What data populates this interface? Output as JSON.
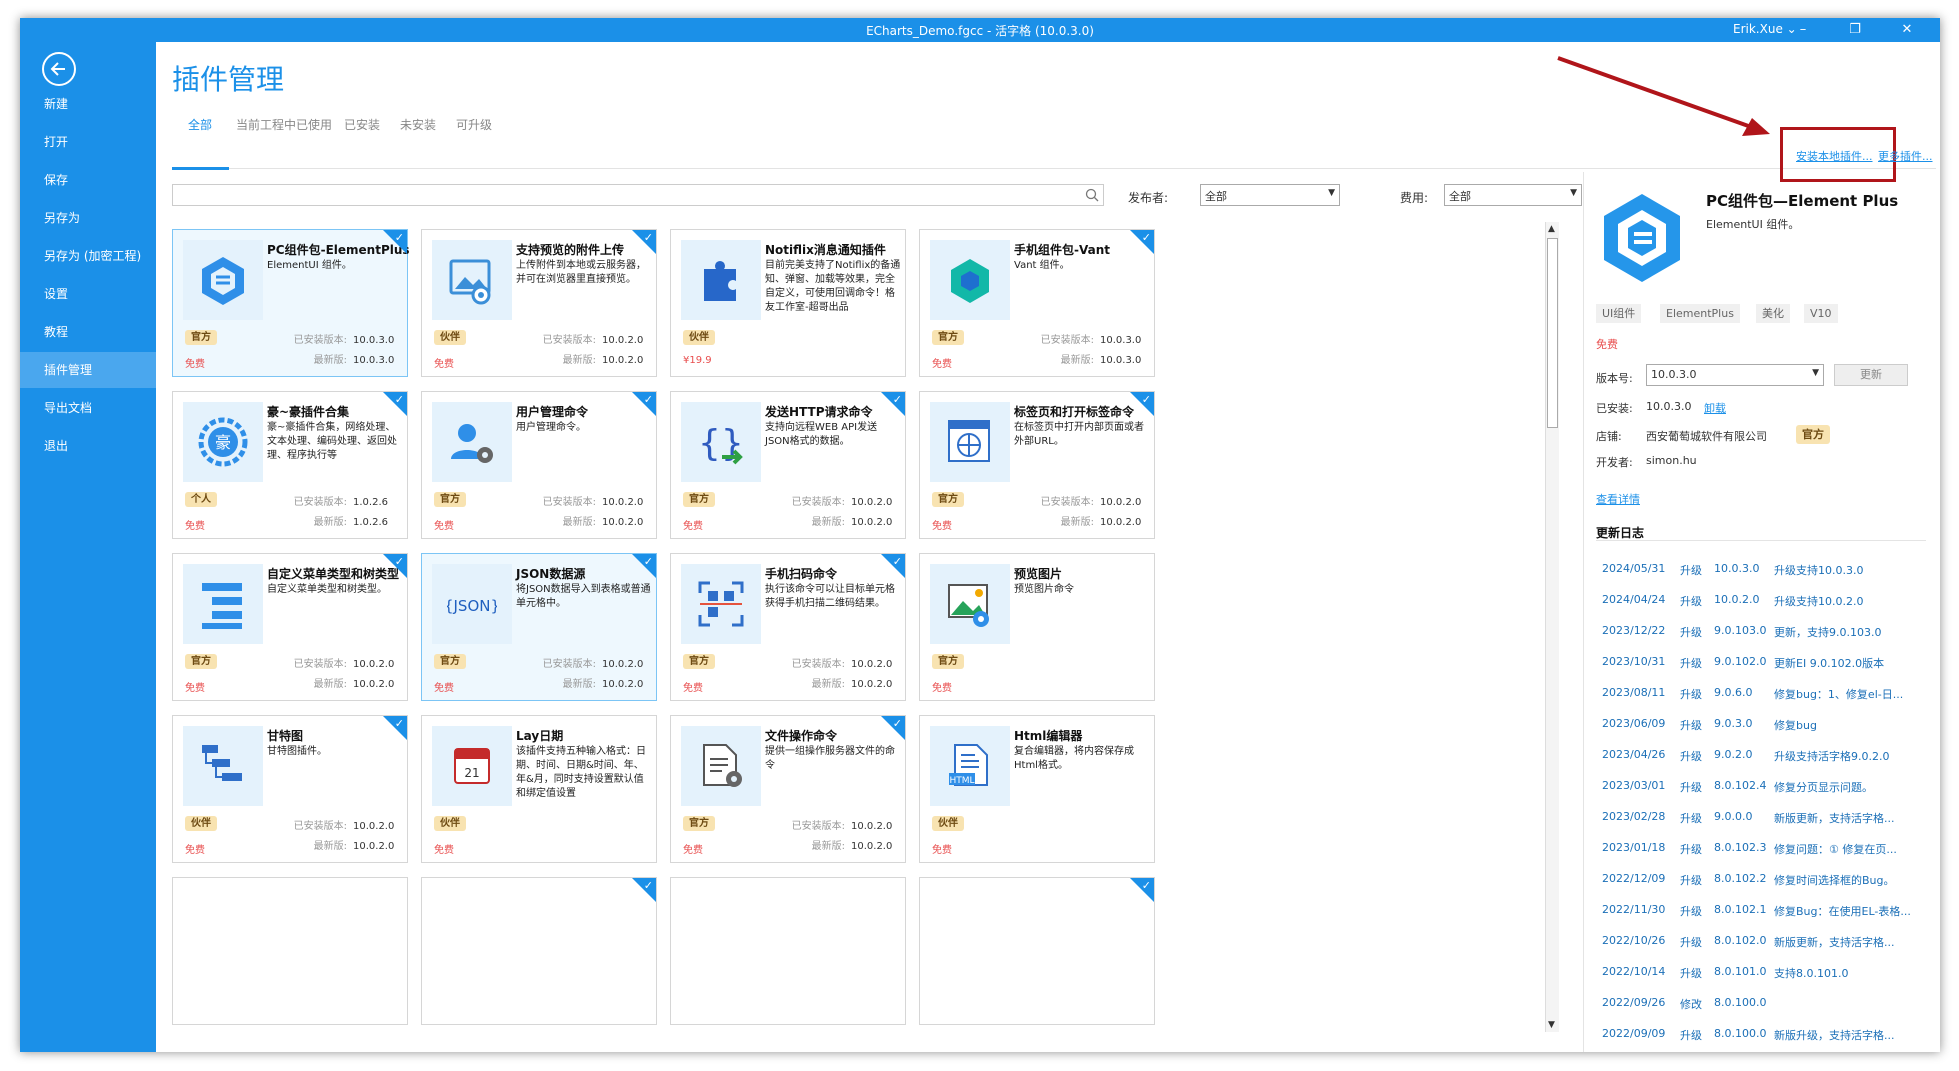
{
  "window": {
    "title": "ECharts_Demo.fgcc - 活字格 (10.0.3.0)",
    "user": "Erik.Xue",
    "minimize": "–",
    "restore": "❐",
    "close": "✕"
  },
  "sidebar": {
    "items": [
      {
        "label": "新建"
      },
      {
        "label": "打开"
      },
      {
        "label": "保存"
      },
      {
        "label": "另存为"
      },
      {
        "label": "另存为 (加密工程)"
      },
      {
        "label": "设置"
      },
      {
        "label": "教程"
      },
      {
        "label": "插件管理"
      },
      {
        "label": "导出文档"
      },
      {
        "label": "退出"
      }
    ],
    "active_index": 7
  },
  "page": {
    "title": "插件管理"
  },
  "tabs": [
    {
      "label": "全部"
    },
    {
      "label": "当前工程中已使用"
    },
    {
      "label": "已安装"
    },
    {
      "label": "未安装"
    },
    {
      "label": "可升级"
    }
  ],
  "filters": {
    "publisher_label": "发布者:",
    "publisher_value": "全部",
    "fee_label": "费用:",
    "fee_value": "全部"
  },
  "links": {
    "install_local": "安装本地插件...",
    "more_plugins": "更多插件..."
  },
  "labels": {
    "installed_version": "已安装版本:",
    "latest_version": "最新版:"
  },
  "cards": [
    {
      "name": "PC组件包-ElementPlus",
      "desc": "ElementUI 组件。",
      "tag": "官方",
      "price": "免费",
      "installed": "10.0.3.0",
      "latest": "10.0.3.0",
      "icon": "elementplus-hexagon-icon",
      "checked": true,
      "selected": true
    },
    {
      "name": "支持预览的附件上传",
      "desc": "上传附件到本地或云服务器，并可在浏览器里直接预览。",
      "tag": "伙伴",
      "price": "免费",
      "installed": "10.0.2.0",
      "latest": "10.0.2.0",
      "icon": "image-preview-icon",
      "checked": true,
      "selected": false
    },
    {
      "name": "Notiflix消息通知插件",
      "desc": "目前完美支持了Notiflix的备通知、弹窗、加载等效果，完全自定义，可使用回调命令！格友工作室-超哥出品",
      "tag": "伙伴",
      "price": "¥19.9",
      "installed": "",
      "latest": "",
      "icon": "puzzle-icon",
      "checked": false,
      "selected": false
    },
    {
      "name": "手机组件包-Vant",
      "desc": "Vant 组件。",
      "tag": "官方",
      "price": "免费",
      "installed": "10.0.3.0",
      "latest": "10.0.3.0",
      "icon": "vant-cube-icon",
      "checked": true,
      "selected": false
    },
    {
      "name": "豪~豪插件合集",
      "desc": "豪~豪插件合集，网络处理、文本处理、编码处理、返回处理、程序执行等",
      "tag": "个人",
      "price": "免费",
      "installed": "1.0.2.6",
      "latest": "1.0.2.6",
      "icon": "hao-badge-icon",
      "checked": true,
      "selected": false
    },
    {
      "name": "用户管理命令",
      "desc": "用户管理命令。",
      "tag": "官方",
      "price": "免费",
      "installed": "10.0.2.0",
      "latest": "10.0.2.0",
      "icon": "user-gear-icon",
      "checked": true,
      "selected": false
    },
    {
      "name": "发送HTTP请求命令",
      "desc": "支持向远程WEB API发送JSON格式的数据。",
      "tag": "官方",
      "price": "免费",
      "installed": "10.0.2.0",
      "latest": "10.0.2.0",
      "icon": "http-braces-icon",
      "checked": true,
      "selected": false
    },
    {
      "name": "标签页和打开标签命令",
      "desc": "在标签页中打开内部页面或者外部URL。",
      "tag": "官方",
      "price": "免费",
      "installed": "10.0.2.0",
      "latest": "10.0.2.0",
      "icon": "browser-globe-icon",
      "checked": true,
      "selected": false
    },
    {
      "name": "自定义菜单类型和树类型",
      "desc": "自定义菜单类型和树类型。",
      "tag": "官方",
      "price": "免费",
      "installed": "10.0.2.0",
      "latest": "10.0.2.0",
      "icon": "tree-menu-icon",
      "checked": true,
      "selected": false
    },
    {
      "name": "JSON数据源",
      "desc": "将JSON数据导入到表格或普通单元格中。",
      "tag": "官方",
      "price": "免费",
      "installed": "10.0.2.0",
      "latest": "10.0.2.0",
      "icon": "json-icon",
      "checked": true,
      "selected": true
    },
    {
      "name": "手机扫码命令",
      "desc": "执行该命令可以让目标单元格获得手机扫描二维码结果。",
      "tag": "官方",
      "price": "免费",
      "installed": "10.0.2.0",
      "latest": "10.0.2.0",
      "icon": "qr-scan-icon",
      "checked": true,
      "selected": false
    },
    {
      "name": "预览图片",
      "desc": "预览图片命令",
      "tag": "官方",
      "price": "免费",
      "installed": "",
      "latest": "",
      "icon": "image-eye-icon",
      "checked": false,
      "selected": false
    },
    {
      "name": "甘特图",
      "desc": "甘特图插件。",
      "tag": "伙伴",
      "price": "免费",
      "installed": "10.0.2.0",
      "latest": "10.0.2.0",
      "icon": "gantt-icon",
      "checked": true,
      "selected": false
    },
    {
      "name": "Lay日期",
      "desc": "该插件支持五种输入格式：日期、时间、日期&时间、年、年&月，同时支持设置默认值和绑定值设置",
      "tag": "伙伴",
      "price": "免费",
      "installed": "",
      "latest": "",
      "icon": "calendar-icon",
      "checked": false,
      "selected": false
    },
    {
      "name": "文件操作命令",
      "desc": "提供一组操作服务器文件的命令",
      "tag": "官方",
      "price": "免费",
      "installed": "10.0.2.0",
      "latest": "10.0.2.0",
      "icon": "file-gear-icon",
      "checked": true,
      "selected": false
    },
    {
      "name": "Html编辑器",
      "desc": "复合编辑器，将内容保存成Html格式。",
      "tag": "伙伴",
      "price": "免费",
      "installed": "",
      "latest": "",
      "icon": "html-doc-icon",
      "checked": false,
      "selected": false
    }
  ],
  "detail": {
    "title": "PC组件包—Element Plus",
    "subtitle": "ElementUI 组件。",
    "chips": [
      "UI组件",
      "ElementPlus",
      "美化",
      "V10"
    ],
    "price": "免费",
    "version_label": "版本号:",
    "version_value": "10.0.3.0",
    "update_button": "更新",
    "installed_label": "已安装:",
    "installed_value": "10.0.3.0",
    "uninstall_link": "卸载",
    "store_label": "店铺:",
    "store_value": "西安葡萄城软件有限公司",
    "store_tag": "官方",
    "developer_label": "开发者:",
    "developer_value": "simon.hu",
    "details_link": "查看详情",
    "changelog_title": "更新日志",
    "changelog": [
      [
        "2024/05/31",
        "升级",
        "10.0.3.0",
        "升级支持10.0.3.0"
      ],
      [
        "2024/04/24",
        "升级",
        "10.0.2.0",
        "升级支持10.0.2.0"
      ],
      [
        "2023/12/22",
        "升级",
        "9.0.103.0",
        "更新，支持9.0.103.0"
      ],
      [
        "2023/10/31",
        "升级",
        "9.0.102.0",
        "更新EI 9.0.102.0版本"
      ],
      [
        "2023/08/11",
        "升级",
        "9.0.6.0",
        "修复bug：1、修复el-日..."
      ],
      [
        "2023/06/09",
        "升级",
        "9.0.3.0",
        "修复bug"
      ],
      [
        "2023/04/26",
        "升级",
        "9.0.2.0",
        "升级支持活字格9.0.2.0"
      ],
      [
        "2023/03/01",
        "升级",
        "8.0.102.4",
        "修复分页显示问题。"
      ],
      [
        "2023/02/28",
        "升级",
        "9.0.0.0",
        "新版更新，支持活字格..."
      ],
      [
        "2023/01/18",
        "升级",
        "8.0.102.3",
        "修复问题：① 修复在页..."
      ],
      [
        "2022/12/09",
        "升级",
        "8.0.102.2",
        "修复时间选择框的Bug。"
      ],
      [
        "2022/11/30",
        "升级",
        "8.0.102.1",
        "修复Bug：在使用EL-表格..."
      ],
      [
        "2022/10/26",
        "升级",
        "8.0.102.0",
        "新版更新，支持活字格..."
      ],
      [
        "2022/10/14",
        "升级",
        "8.0.101.0",
        "支持8.0.101.0"
      ],
      [
        "2022/09/26",
        "修改",
        "8.0.100.0",
        ""
      ],
      [
        "2022/09/09",
        "升级",
        "8.0.100.0",
        "新版升级，支持活字格..."
      ]
    ]
  },
  "colors": {
    "primary": "#1b90e8",
    "annotation": "#b0151a",
    "tag_bg": "#f8e3b1",
    "price": "#e84d4d"
  }
}
